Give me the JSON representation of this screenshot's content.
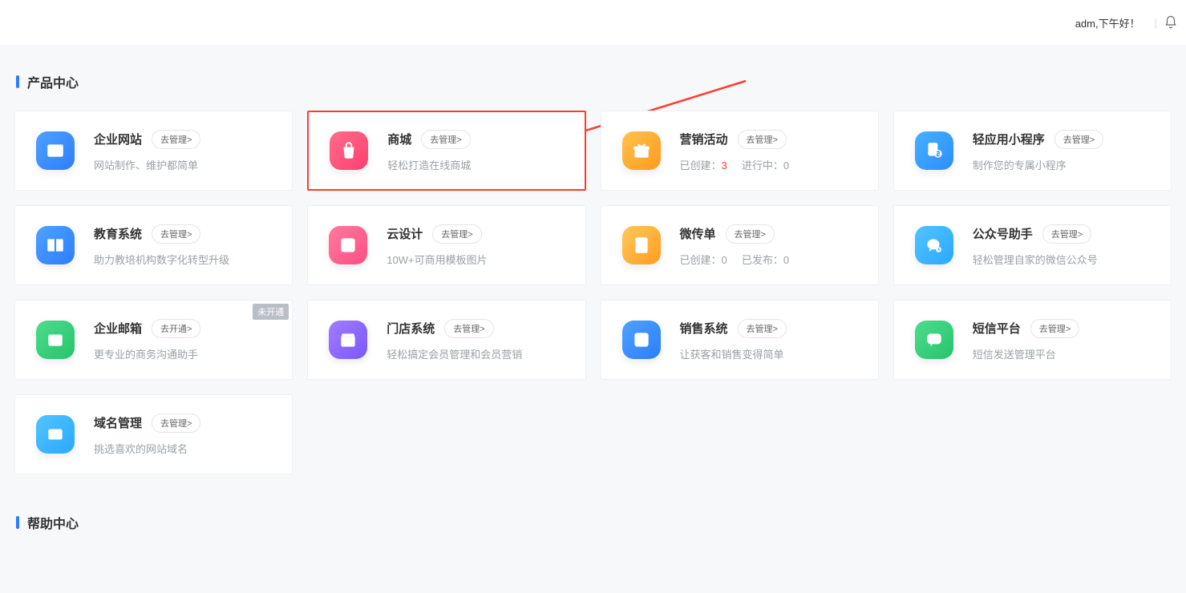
{
  "header": {
    "greeting": "adm,下午好！"
  },
  "sections": {
    "products_title": "产品中心",
    "help_title": "帮助中心"
  },
  "cards": [
    {
      "id": "site",
      "icon": "window-icon",
      "bg": "bg-blue",
      "title": "企业网站",
      "button": "去管理>",
      "desc": "网站制作、维护都简单"
    },
    {
      "id": "mall",
      "icon": "bag-icon",
      "bg": "bg-pink",
      "title": "商城",
      "button": "去管理>",
      "desc": "轻松打造在线商城",
      "highlight": true
    },
    {
      "id": "marketing",
      "icon": "gift-icon",
      "bg": "bg-orange",
      "title": "营销活动",
      "button": "去管理>",
      "stat1_label": "已创建：",
      "stat1_value": "3",
      "stat2_label": "进行中：",
      "stat2_value": "0"
    },
    {
      "id": "miniapp",
      "icon": "miniapp-icon",
      "bg": "bg-blue2",
      "title": "轻应用小程序",
      "button": "去管理>",
      "desc": "制作您的专属小程序"
    },
    {
      "id": "education",
      "icon": "book-icon",
      "bg": "bg-blue",
      "title": "教育系统",
      "button": "去管理>",
      "desc": "助力教培机构数字化转型升级"
    },
    {
      "id": "design",
      "icon": "image-icon",
      "bg": "bg-pink2",
      "title": "云设计",
      "button": "去管理>",
      "desc": "10W+可商用模板图片"
    },
    {
      "id": "flyer",
      "icon": "flyer-icon",
      "bg": "bg-orange2",
      "title": "微传单",
      "button": "去管理>",
      "stat1_label": "已创建：",
      "stat1_value": "0",
      "stat2_label": "已发布：",
      "stat2_value": "0"
    },
    {
      "id": "wechat",
      "icon": "wechat-icon",
      "bg": "bg-lblue",
      "title": "公众号助手",
      "button": "去管理>",
      "desc": "轻松管理自家的微信公众号"
    },
    {
      "id": "mail",
      "icon": "mail-icon",
      "bg": "bg-green",
      "title": "企业邮箱",
      "button": "去开通>",
      "desc": "更专业的商务沟通助手",
      "tag": "未开通"
    },
    {
      "id": "store",
      "icon": "store-icon",
      "bg": "bg-purple",
      "title": "门店系统",
      "button": "去管理>",
      "desc": "轻松搞定会员管理和会员营销"
    },
    {
      "id": "sales",
      "icon": "list-icon",
      "bg": "bg-blue",
      "title": "销售系统",
      "button": "去管理>",
      "desc": "让获客和销售变得简单"
    },
    {
      "id": "sms",
      "icon": "chat-icon",
      "bg": "bg-green",
      "title": "短信平台",
      "button": "去管理>",
      "desc": "短信发送管理平台"
    },
    {
      "id": "domain",
      "icon": "domain-icon",
      "bg": "bg-lblue",
      "title": "域名管理",
      "button": "去管理>",
      "desc": "挑选喜欢的网站域名"
    }
  ]
}
